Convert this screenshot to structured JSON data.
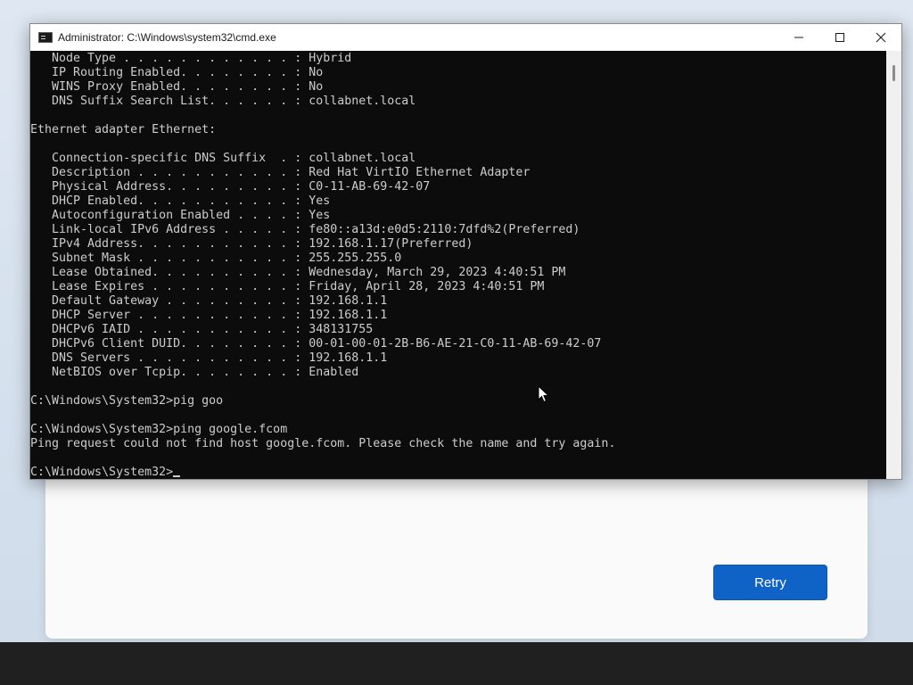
{
  "window": {
    "title": "Administrator: C:\\Windows\\system32\\cmd.exe",
    "icon": "cmd-icon"
  },
  "controls": {
    "minimize": "minimize-icon",
    "maximize": "maximize-icon",
    "close": "close-icon"
  },
  "console": {
    "lines": [
      "   Node Type . . . . . . . . . . . . : Hybrid",
      "   IP Routing Enabled. . . . . . . . : No",
      "   WINS Proxy Enabled. . . . . . . . : No",
      "   DNS Suffix Search List. . . . . . : collabnet.local",
      "",
      "Ethernet adapter Ethernet:",
      "",
      "   Connection-specific DNS Suffix  . : collabnet.local",
      "   Description . . . . . . . . . . . : Red Hat VirtIO Ethernet Adapter",
      "   Physical Address. . . . . . . . . : C0-11-AB-69-42-07",
      "   DHCP Enabled. . . . . . . . . . . : Yes",
      "   Autoconfiguration Enabled . . . . : Yes",
      "   Link-local IPv6 Address . . . . . : fe80::a13d:e0d5:2110:7dfd%2(Preferred)",
      "   IPv4 Address. . . . . . . . . . . : 192.168.1.17(Preferred)",
      "   Subnet Mask . . . . . . . . . . . : 255.255.255.0",
      "   Lease Obtained. . . . . . . . . . : Wednesday, March 29, 2023 4:40:51 PM",
      "   Lease Expires . . . . . . . . . . : Friday, April 28, 2023 4:40:51 PM",
      "   Default Gateway . . . . . . . . . : 192.168.1.1",
      "   DHCP Server . . . . . . . . . . . : 192.168.1.1",
      "   DHCPv6 IAID . . . . . . . . . . . : 348131755",
      "   DHCPv6 Client DUID. . . . . . . . : 00-01-00-01-2B-B6-AE-21-C0-11-AB-69-42-07",
      "   DNS Servers . . . . . . . . . . . : 192.168.1.1",
      "   NetBIOS over Tcpip. . . . . . . . : Enabled",
      "",
      "C:\\Windows\\System32>pig goo",
      "",
      "C:\\Windows\\System32>ping google.fcom",
      "Ping request could not find host google.fcom. Please check the name and try again.",
      "",
      "C:\\Windows\\System32>"
    ]
  },
  "background_dialog": {
    "retry_label": "Retry"
  },
  "colors": {
    "console_bg": "#0c0c0c",
    "console_fg": "#cccccc",
    "accent": "#0f62c6"
  }
}
